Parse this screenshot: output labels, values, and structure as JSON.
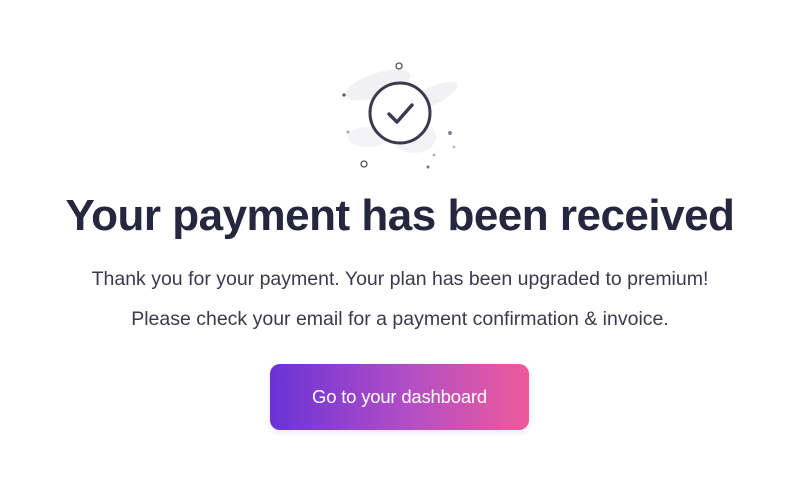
{
  "illustration": {
    "icon": "check-circle-icon"
  },
  "heading": {
    "title": "Your payment has been received"
  },
  "message": {
    "line1": "Thank you for your payment. Your plan has been upgraded to premium!",
    "line2": "Please check your email for a payment confirmation & invoice."
  },
  "cta": {
    "label": "Go to your dashboard"
  },
  "colors": {
    "heading": "#26263f",
    "body_text": "#3a3a4d",
    "icon_stroke": "#3a3a4d",
    "button_gradient_start": "#6a33d6",
    "button_gradient_end": "#ee5a9a",
    "button_text": "#ffffff"
  }
}
